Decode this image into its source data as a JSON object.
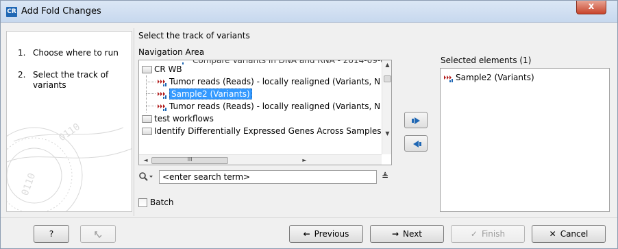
{
  "window": {
    "title": "Add Fold Changes",
    "app_icon_text": "CR",
    "close_glyph": "x"
  },
  "steps": [
    {
      "number": "1.",
      "label": "Choose where to run"
    },
    {
      "number": "2.",
      "label": "Select the track of variants"
    }
  ],
  "main": {
    "section_title": "Select the track of variants",
    "navigation_label": "Navigation Area",
    "tree": {
      "partial_top": "Compare Variants in DNA and RNA - 2014-09-0",
      "items": [
        {
          "label": "CR WB",
          "icon": "folder-icon"
        },
        {
          "label": "Tumor reads (Reads) - locally realigned (Variants, N",
          "icon": "variant-track-icon"
        },
        {
          "label": "Sample2 (Variants)",
          "icon": "variant-track-icon",
          "selected": true
        },
        {
          "label": "Tumor reads (Reads) - locally realigned (Variants, N",
          "icon": "variant-track-icon"
        },
        {
          "label": "test workflows",
          "icon": "folder-icon"
        },
        {
          "label": "Identify Differentially Expressed Genes Across Samples",
          "icon": "folder-icon"
        }
      ],
      "hscroll_thumb_glyph": "III"
    },
    "search": {
      "placeholder": "<enter search term>",
      "value": "<enter search term>"
    },
    "batch_label": "Batch",
    "selected_label": "Selected elements (1)",
    "selected_items": [
      {
        "label": "Sample2 (Variants)",
        "icon": "variant-track-icon"
      }
    ]
  },
  "footer": {
    "help_label": "?",
    "previous_label": "Previous",
    "next_label": "Next",
    "finish_label": "Finish",
    "cancel_label": "Cancel"
  },
  "colors": {
    "selection": "#3399ff",
    "arrow_blue": "#1f67b4",
    "variant_red": "#b01818",
    "variant_blue": "#1f67b4"
  }
}
